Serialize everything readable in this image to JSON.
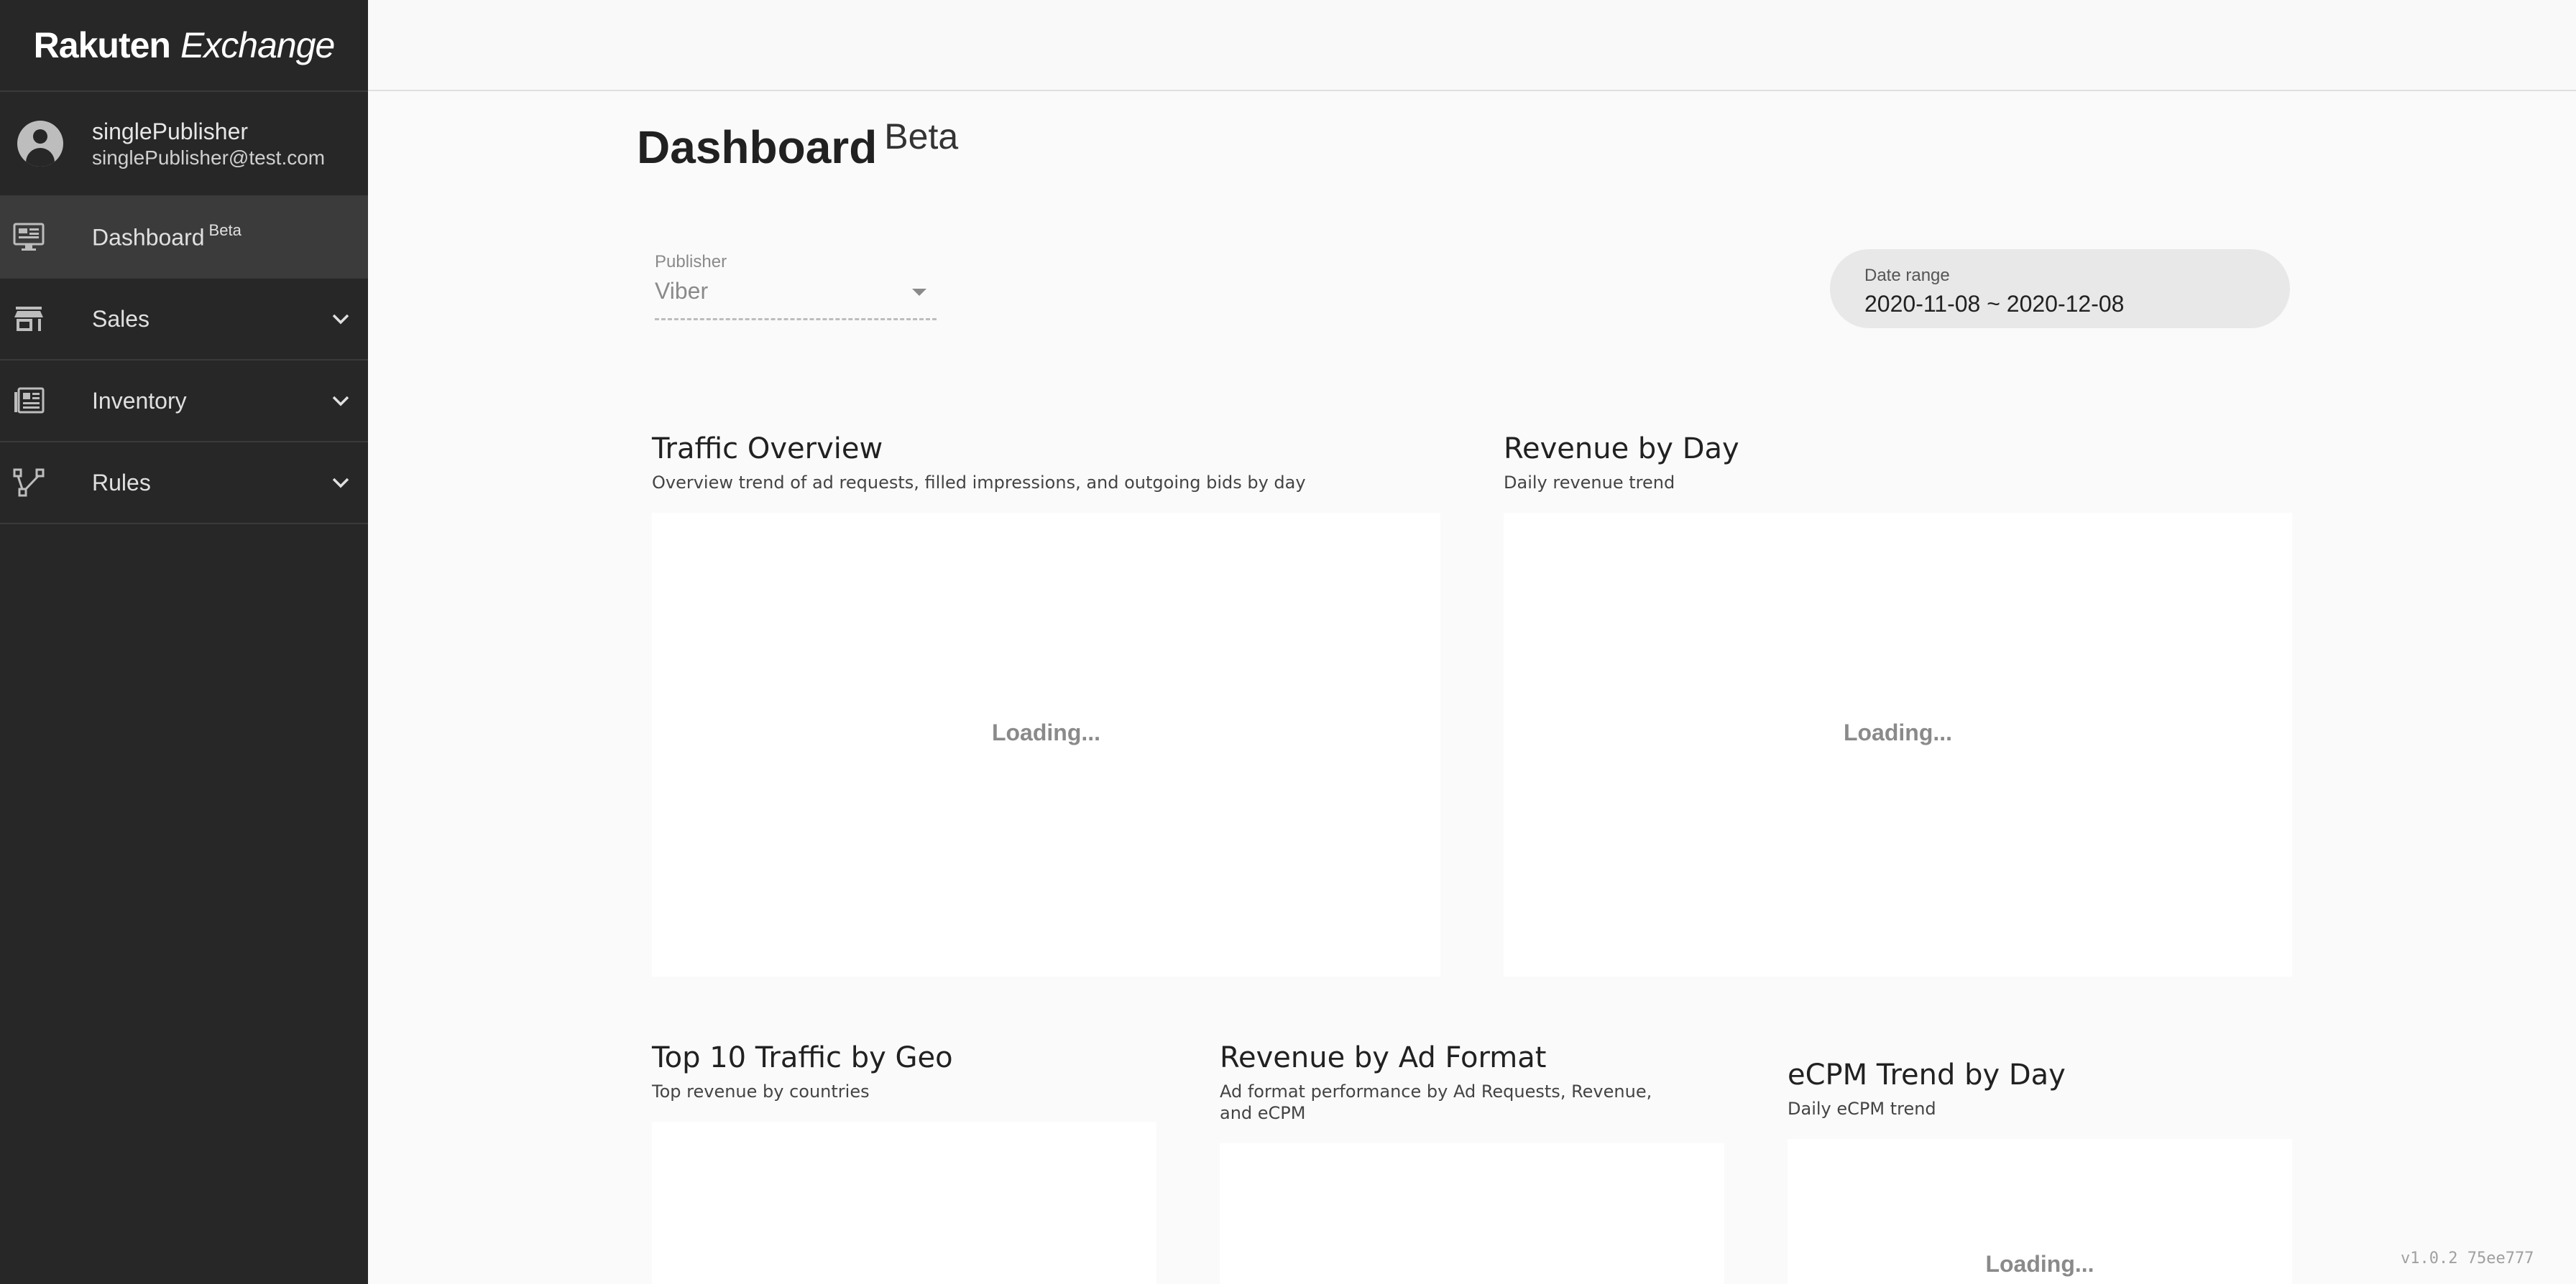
{
  "brand": {
    "logo_word_bold": "Rakuten",
    "logo_word_italic": "Exchange"
  },
  "user": {
    "name": "singlePublisher",
    "email": "singlePublisher@test.com",
    "avatar_icon": "account-circle-icon"
  },
  "sidebar": {
    "items": [
      {
        "label": "Dashboard",
        "badge": "Beta",
        "icon": "monitor-dashboard-icon",
        "active": true
      },
      {
        "label": "Sales",
        "icon": "store-icon",
        "expandable": true
      },
      {
        "label": "Inventory",
        "icon": "newspaper-icon",
        "expandable": true
      },
      {
        "label": "Rules",
        "icon": "branch-icon",
        "expandable": true
      }
    ]
  },
  "page": {
    "title": "Dashboard",
    "title_badge": "Beta"
  },
  "filters": {
    "publisher": {
      "label": "Publisher",
      "value": "Viber"
    },
    "date_range": {
      "label": "Date range",
      "value": "2020-11-08 ~ 2020-12-08"
    }
  },
  "cards": {
    "traffic_overview": {
      "title": "Traffic Overview",
      "subtitle": "Overview trend of ad requests, filled impressions, and outgoing bids by day",
      "status": "Loading..."
    },
    "revenue_by_day": {
      "title": "Revenue by Day",
      "subtitle": "Daily revenue trend",
      "status": "Loading..."
    },
    "top10_geo": {
      "title": "Top 10 Traffic by Geo",
      "subtitle": "Top revenue by countries"
    },
    "revenue_ad_format": {
      "title": "Revenue by Ad Format",
      "subtitle_line1": "Ad format performance by Ad Requests, Revenue,",
      "subtitle_line2": "and eCPM"
    },
    "ecpm_trend": {
      "title": "eCPM Trend by Day",
      "subtitle": "Daily eCPM trend",
      "status": "Loading..."
    }
  },
  "footer": {
    "version": "v1.0.2 75ee777"
  },
  "colors": {
    "sidebar_bg": "#272727",
    "sidebar_active": "#3b3b3b",
    "page_bg": "#fafafa",
    "card_bg": "#ffffff",
    "pill_bg": "#e8e8e8"
  }
}
